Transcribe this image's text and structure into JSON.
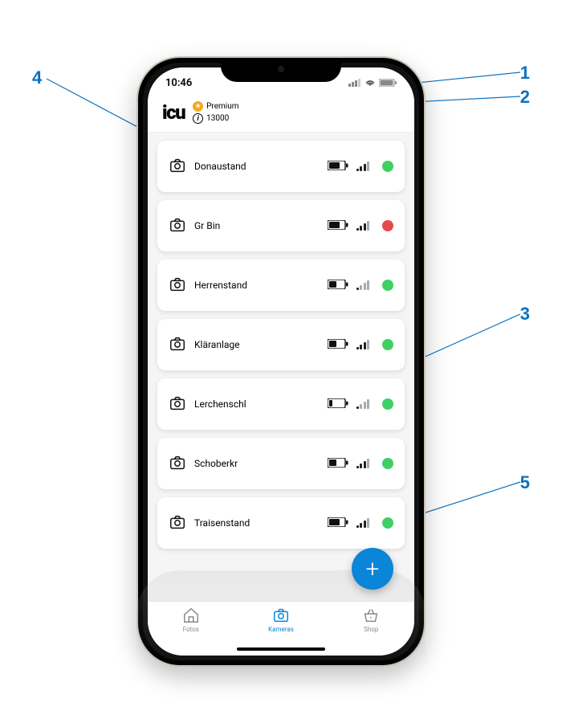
{
  "statusbar": {
    "time": "10:46"
  },
  "header": {
    "brand": "icu",
    "premium_label": "Premium",
    "credits": "13000"
  },
  "cameras": [
    {
      "name": "Donaustand",
      "battery": "high",
      "signal": 3,
      "status": "green"
    },
    {
      "name": "Gr Bin",
      "battery": "high",
      "signal": 3,
      "status": "red"
    },
    {
      "name": "Herrenstand",
      "battery": "mid",
      "signal": 1,
      "status": "green"
    },
    {
      "name": "Kläranlage",
      "battery": "mid",
      "signal": 3,
      "status": "green"
    },
    {
      "name": "Lerchenschl",
      "battery": "low",
      "signal": 1,
      "status": "green"
    },
    {
      "name": "Schoberkr",
      "battery": "mid",
      "signal": 3,
      "status": "green"
    },
    {
      "name": "Traisenstand",
      "battery": "high",
      "signal": 3,
      "status": "green"
    }
  ],
  "tabs": {
    "fotos": "Fotos",
    "kameras": "Kameras",
    "shop": "Shop"
  },
  "callouts": {
    "1": "1",
    "2": "2",
    "3": "3",
    "4": "4",
    "5": "5"
  }
}
